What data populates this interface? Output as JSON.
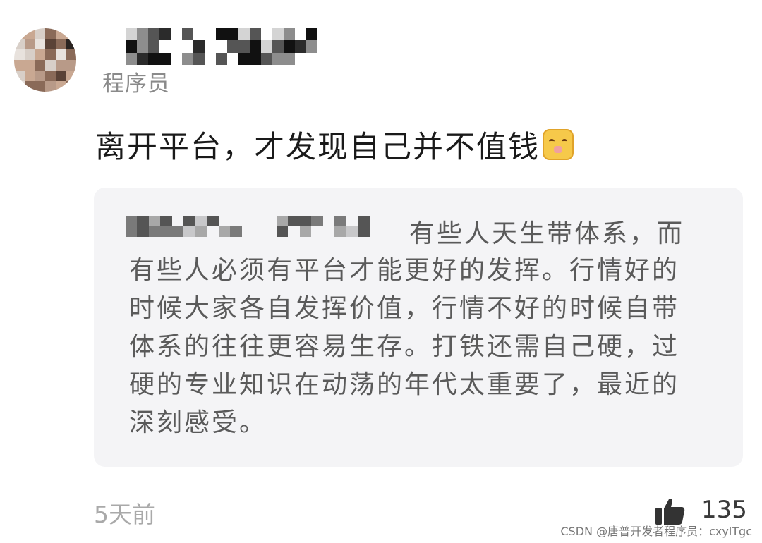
{
  "comment": {
    "author_role": "程序员",
    "text": "离开平台，才发现自己并不值钱",
    "emoji": "smirk-emoji",
    "quote": {
      "first_line": "有些人天生带体系，而",
      "lines": [
        "有些人必须有平台才能更好的发挥。行情好的",
        "时候大家各自发挥价值，行情不好的时候自带",
        "体系的往往更容易生存。打铁还需自己硬，过",
        "硬的专业知识在动荡的年代太重要了，最近的",
        "深刻感受。"
      ]
    },
    "time": "5天前",
    "likes": "135"
  },
  "watermark": "CSDN @唐普开发者程序员：cxylTgc",
  "colors": {
    "quote_background": "#f4f4f6",
    "primary_text": "#1a1a1a",
    "secondary_text": "#8a8a8a",
    "quote_text": "#5a5a5a"
  }
}
